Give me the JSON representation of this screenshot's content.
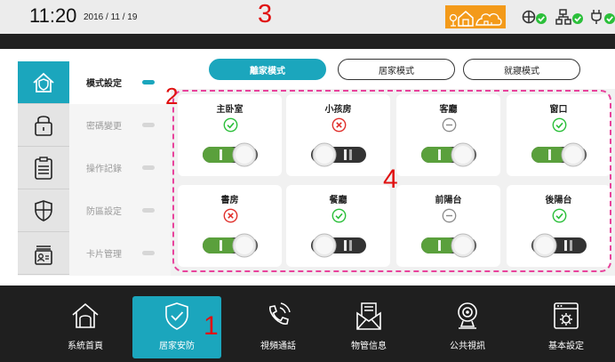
{
  "status": {
    "time": "11:20",
    "date": "2016 / 11 / 19"
  },
  "callouts": {
    "one": "1",
    "two": "2",
    "three": "3",
    "four": "4"
  },
  "menu": {
    "items": [
      {
        "label": "模式設定",
        "icon": "home-shield-icon",
        "active": true
      },
      {
        "label": "密碼變更",
        "icon": "padlock-icon",
        "active": false
      },
      {
        "label": "操作記錄",
        "icon": "clipboard-icon",
        "active": false
      },
      {
        "label": "防區設定",
        "icon": "shield-cross-icon",
        "active": false
      },
      {
        "label": "卡片管理",
        "icon": "id-card-icon",
        "active": false
      }
    ]
  },
  "modes": {
    "tabs": [
      {
        "label": "離家模式",
        "active": true
      },
      {
        "label": "居家模式",
        "active": false
      },
      {
        "label": "就寢模式",
        "active": false
      }
    ]
  },
  "rooms": [
    {
      "name": "主卧室",
      "status": "armed",
      "on": true
    },
    {
      "name": "小孩房",
      "status": "error",
      "on": false
    },
    {
      "name": "客廳",
      "status": "bypass",
      "on": true
    },
    {
      "name": "窗口",
      "status": "armed",
      "on": true
    },
    {
      "name": "書房",
      "status": "error",
      "on": true
    },
    {
      "name": "餐廳",
      "status": "armed",
      "on": false
    },
    {
      "name": "前陽台",
      "status": "bypass",
      "on": true
    },
    {
      "name": "後陽台",
      "status": "armed",
      "on": false
    }
  ],
  "nav": {
    "items": [
      {
        "label": "系統首頁",
        "icon": "house-icon",
        "active": false
      },
      {
        "label": "居家安防",
        "icon": "shield-check-icon",
        "active": true
      },
      {
        "label": "視頻通話",
        "icon": "phone-call-icon",
        "active": false
      },
      {
        "label": "物管信息",
        "icon": "envelope-doc-icon",
        "active": false
      },
      {
        "label": "公共視訊",
        "icon": "webcam-icon",
        "active": false
      },
      {
        "label": "基本設定",
        "icon": "settings-window-icon",
        "active": false
      }
    ]
  },
  "colors": {
    "accent": "#1ba6bd",
    "orange": "#f39a1a",
    "green": "#2bbf3a",
    "red": "#e0302c",
    "grey": "#8a8a8a",
    "toggle_on": "#5aa03c",
    "dash": "#e8439c"
  }
}
